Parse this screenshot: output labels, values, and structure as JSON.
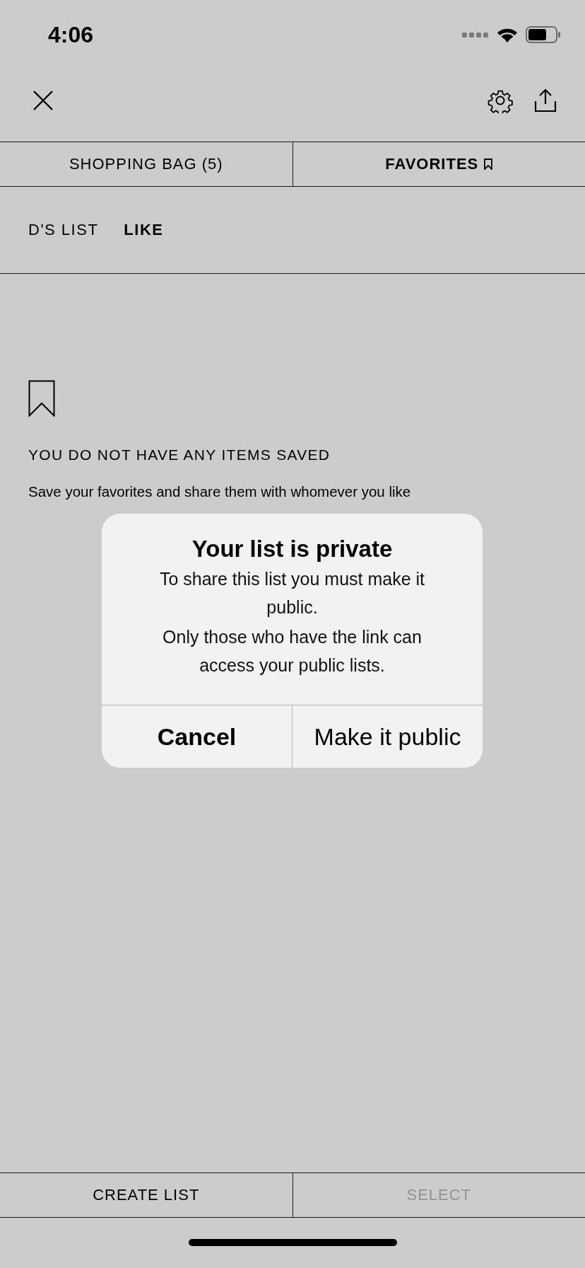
{
  "status_bar": {
    "time": "4:06"
  },
  "tabs": [
    {
      "label": "SHOPPING BAG (5)",
      "selected": false,
      "icon": false
    },
    {
      "label": "FAVORITES",
      "selected": true,
      "icon": true
    }
  ],
  "list_tabs": [
    {
      "label": "D'S LIST",
      "selected": false
    },
    {
      "label": "LIKE",
      "selected": true
    }
  ],
  "empty_state": {
    "title": "YOU DO NOT HAVE ANY ITEMS SAVED",
    "message": "Save your favorites and share them with whomever you like"
  },
  "dialog": {
    "title": "Your list is private",
    "body": [
      "To share this list you must make it public.",
      "Only those who have the link can access your public lists."
    ],
    "buttons": [
      {
        "label": "Cancel",
        "kind": "cancel"
      },
      {
        "label": "Make it public",
        "kind": "default"
      }
    ]
  },
  "bottom_buttons": [
    {
      "label": "CREATE LIST",
      "disabled": false
    },
    {
      "label": "SELECT",
      "disabled": true
    }
  ]
}
